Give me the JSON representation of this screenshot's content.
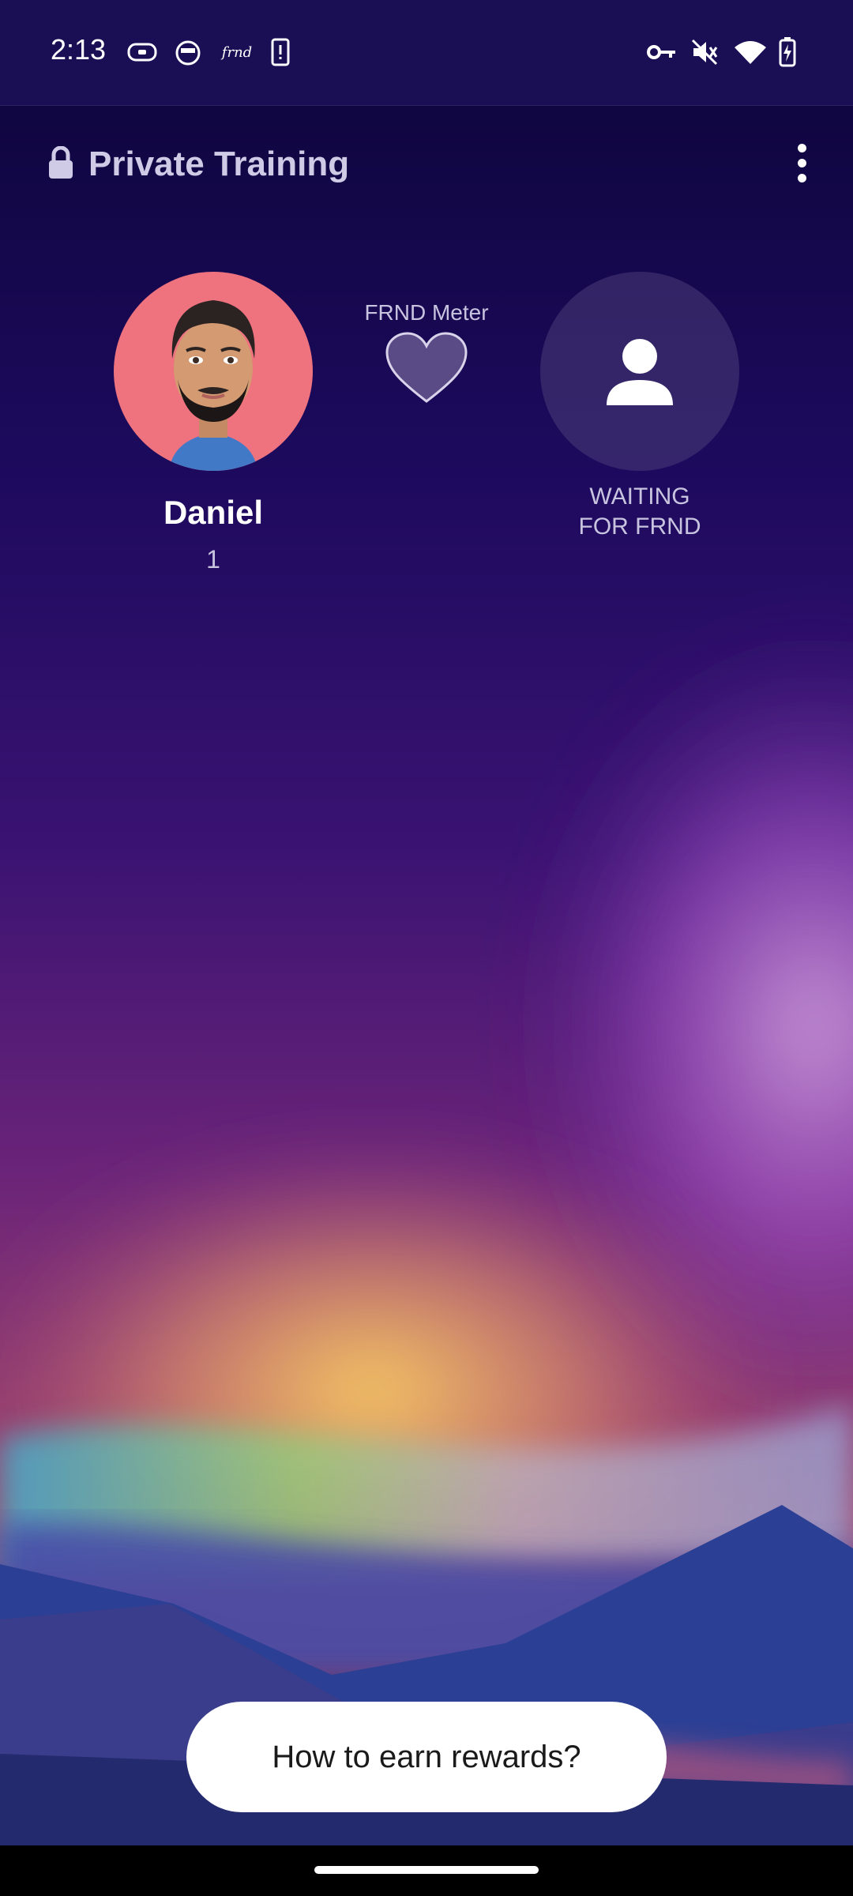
{
  "status_bar": {
    "time": "2:13",
    "left_icons": [
      "game-controller-icon",
      "cat-face-icon",
      "frnd-logo-icon",
      "phone-alert-icon"
    ],
    "frnd_logo_text": "frnd",
    "right_icons": [
      "vpn-key-icon",
      "muted-icon",
      "wifi-icon",
      "battery-charging-icon"
    ]
  },
  "header": {
    "title": "Private Training",
    "lock_icon": "lock-icon",
    "menu_icon": "more-vert-icon"
  },
  "me": {
    "name": "Daniel",
    "level": "1",
    "avatar_bg": "#ee737f"
  },
  "meter": {
    "label": "FRND Meter",
    "icon": "heart-icon"
  },
  "friend": {
    "status": "WAITING\nFOR FRND",
    "icon": "person-icon"
  },
  "actions": {
    "rewards_label": "How to earn rewards?"
  },
  "colors": {
    "background_top": "#0d0640",
    "status_bar": "#1a0f55",
    "glow_yellow": "#f6c15f",
    "glow_purple": "#a24bc0",
    "button_bg": "#ffffff"
  }
}
